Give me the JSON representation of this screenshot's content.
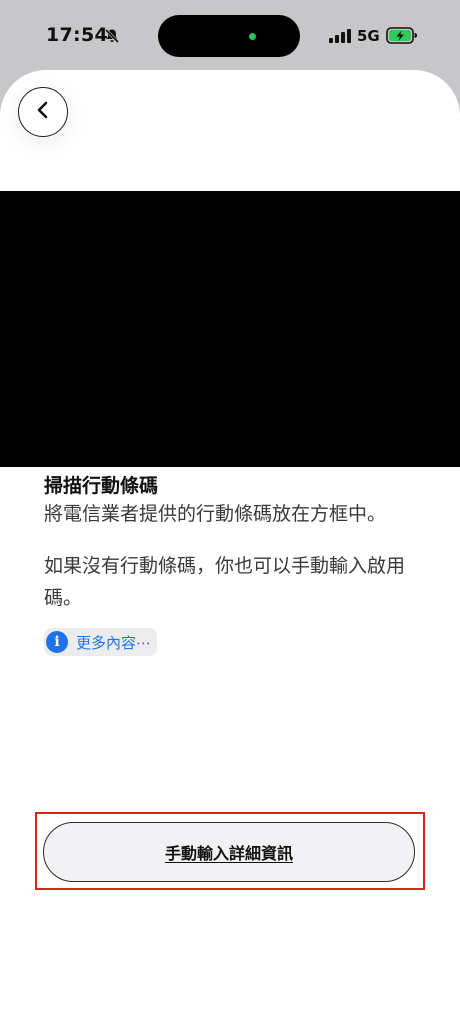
{
  "status_bar": {
    "time": "17:54",
    "network": "5G",
    "icons": [
      "bell-slash-icon",
      "signal-bars-icon",
      "battery-charging-icon"
    ],
    "colors": {
      "battery": "#34c759",
      "island_dot": "#22c55e"
    }
  },
  "nav": {
    "back_icon": "chevron-left-icon"
  },
  "scan": {
    "title": "掃描行動條碼",
    "instruction": "將電信業者提供的行動條碼放在方框中。",
    "alternative": "如果沒有行動條碼，你也可以手動輸入啟用碼。",
    "more_icon": "info-icon",
    "more_label": "更多內容⋯"
  },
  "actions": {
    "manual_entry_label": "手動輸入詳細資訊"
  },
  "colors": {
    "accent": "#1f73e8",
    "highlight": "#e0201b"
  }
}
